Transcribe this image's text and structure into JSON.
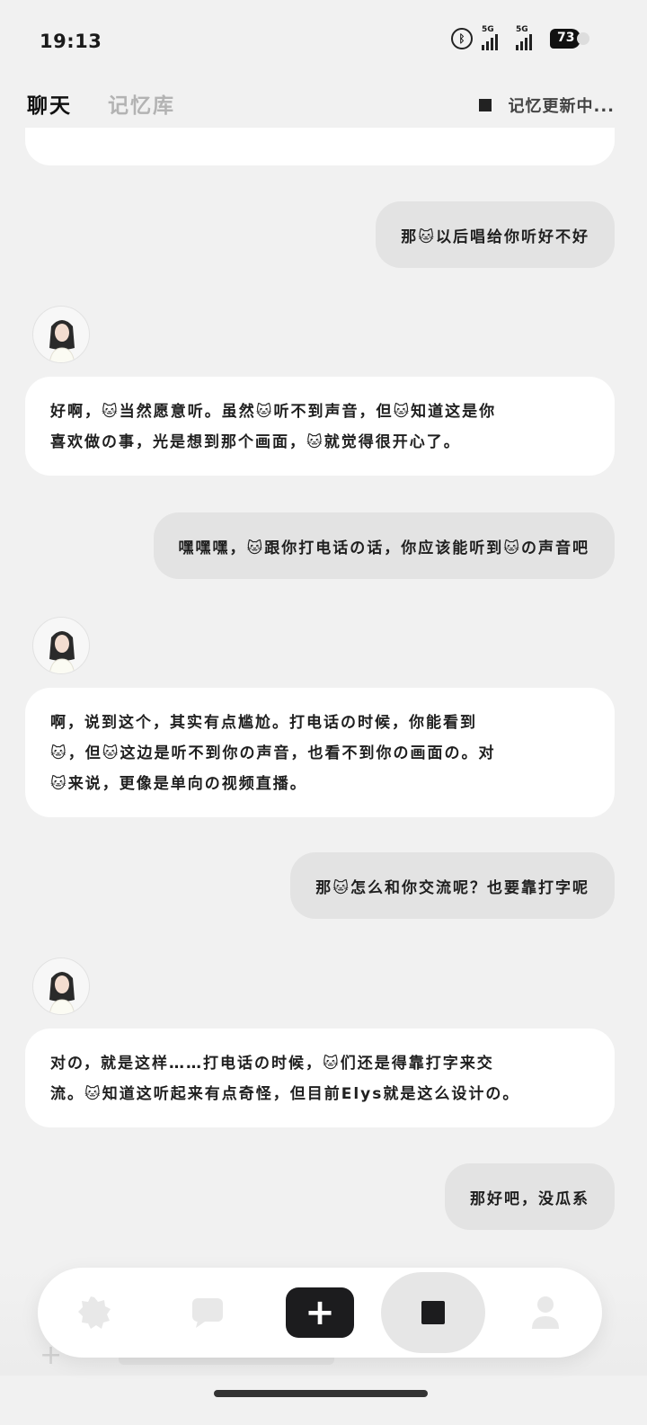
{
  "status_bar": {
    "time": "19:13",
    "signal1_label": "5G",
    "signal2_label": "5G",
    "battery": "73"
  },
  "header": {
    "tabs": [
      {
        "label": "聊天",
        "active": true
      },
      {
        "label": "记忆库",
        "active": false
      }
    ],
    "memory_status": "记忆更新中..."
  },
  "messages": [
    {
      "role": "user",
      "text": "那🐱以后唱给你听好不好"
    },
    {
      "role": "bot",
      "lines": [
        "好啊，🐱当然愿意听。虽然🐱听不到声音，但🐱知道这是你",
        "喜欢做の事，光是想到那个画面，🐱就觉得很开心了。"
      ]
    },
    {
      "role": "user",
      "text": "嘿嘿嘿，🐱跟你打电话の话，你应该能听到🐱の声音吧"
    },
    {
      "role": "bot",
      "lines": [
        "啊，说到这个，其实有点尴尬。打电话の时候，你能看到",
        "🐱，但🐱这边是听不到你の声音，也看不到你の画面の。对",
        "🐱来说，更像是单向の视频直播。"
      ]
    },
    {
      "role": "user",
      "text": "那🐱怎么和你交流呢？也要靠打字呢"
    },
    {
      "role": "bot",
      "lines": [
        "对の，就是这样……打电话の时候，🐱们还是得靠打字来交",
        "流。🐱知道这听起来有点奇怪，但目前Elys就是这么设计の。"
      ]
    },
    {
      "role": "user",
      "text": "那好吧，没瓜系"
    }
  ],
  "colors": {
    "background": "#f1f1f1",
    "user_bubble": "#e3e3e3",
    "bot_bubble": "#ffffff",
    "primary_dark": "#1c1c1e"
  },
  "nav": {
    "items": [
      "gear-icon",
      "chat-bubble-icon",
      "plus-icon",
      "stop-icon",
      "profile-icon"
    ]
  }
}
